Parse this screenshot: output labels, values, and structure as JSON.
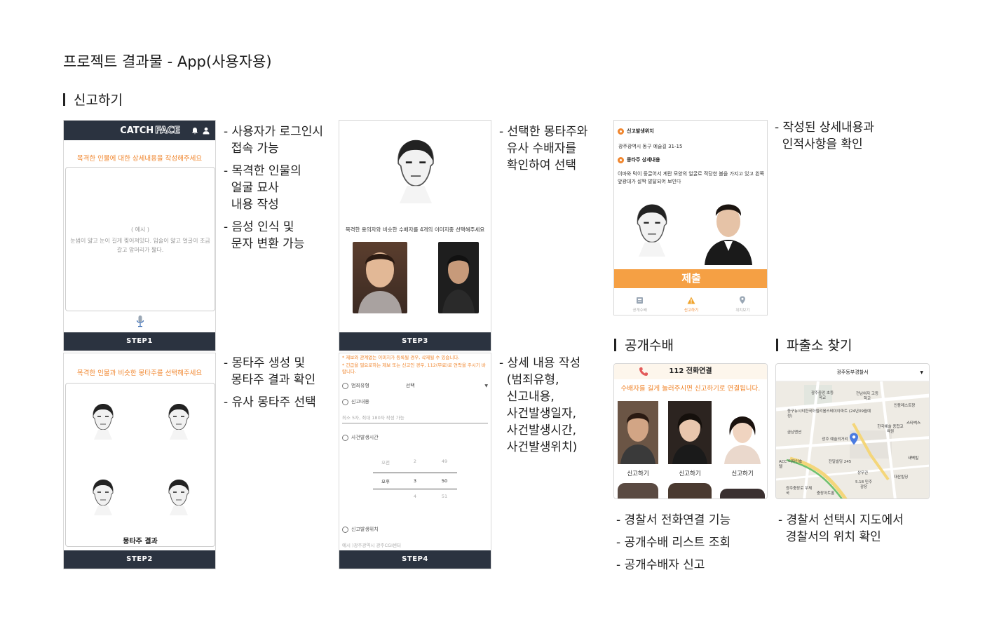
{
  "page_title": "프로젝트 결과물 - App(사용자용)",
  "sections": {
    "report": "신고하기",
    "wanted": "공개수배",
    "police": "파출소 찾기"
  },
  "phone1": {
    "logo_catch": "CATCH",
    "logo_face": "FACE",
    "prompt": "목격한 인물에 대한 상세내용을 작성해주세요",
    "example_label": "( 예시 )",
    "example_text": "눈썹이 얇고 눈이 길게 찢어져있다. 입술이 얇고 얼굴이 조금 갈고 앞머리가 짧다.",
    "step": "STEP1"
  },
  "phone2": {
    "prompt": "목격한 인물과 비슷한 몽타주를 선택해주세요",
    "result_label": "몽타주 결과",
    "step": "STEP2"
  },
  "phone3": {
    "prompt": "목격한 용의자와 비슷한 수배자를 4개의 이미지중 선택해주세요",
    "step": "STEP3"
  },
  "phone4": {
    "notice1": "* 제보와 관계없는 이미지가 등록될 경우, 삭제될 수 있습니다.",
    "notice2": "* 긴급을 필요로하는 제보 또는 신고인 경우, 112(무료)로 연락을 주시기 바랍니다.",
    "crime_type_label": "범죄유형",
    "crime_type_value": "선택",
    "content_label": "신고내용",
    "content_placeholder": "최소 5자, 최대 180자 작성 가능",
    "time_label": "사건발생시간",
    "time_rows": [
      [
        "오전",
        "2",
        "49"
      ],
      [
        "오후",
        "3",
        "50"
      ],
      [
        "",
        "4",
        "51"
      ]
    ],
    "location_label": "신고발생위치",
    "location_placeholder": "예시 )광주광역시 광주CGI센터",
    "step": "STEP4"
  },
  "phone5": {
    "loc_label": "신고발생위치",
    "loc_value": "광주광역시 동구 예술길 31-15",
    "detail_label": "몽타주 상세내용",
    "detail_text": "이마와 턱이 둥글어서 계란 모양의 얼굴로 적당한 볼을 가지고 있고 왼쪽 앞광대가 살짝 발달되어 보인다",
    "submit": "제출",
    "nav": [
      "공개수배",
      "신고하기",
      "위치보기"
    ]
  },
  "phone6": {
    "header": "112 전화연결",
    "banner": "수배자를 길게 눌러주시면 신고하기로 연결됩니다.",
    "report_btn": "신고하기"
  },
  "phone7": {
    "select_value": "광주동부경찰서",
    "map_labels": [
      "광주중앙 초등학교",
      "전남여자 고등학교",
      "동구뉴시티한국아델리움스테이아파트 (24년09월예정)",
      "인동레스트장",
      "한국예술 종합교육원",
      "광주 예술의거리",
      "금남맨션",
      "전일빌딩 245",
      "ACC 디자인호텔",
      "상무관",
      "광주충장로 우체국",
      "충장아트홀",
      "5.18 민주광장",
      "대산빌딩",
      "스타벅스",
      "새벽빌"
    ]
  },
  "descriptions": {
    "d1": [
      "- 사용자가 로그인시",
      "  접속 가능"
    ],
    "d2": [
      "- 목격한 인물의",
      "  얼굴 묘사",
      "  내용 작성"
    ],
    "d3": [
      "- 음성 인식 및",
      "  문자 변환 가능"
    ],
    "d4": [
      "- 몽타주 생성 및",
      "  몽타주 결과 확인"
    ],
    "d5": [
      "- 유사 몽타주 선택"
    ],
    "d6": [
      "- 선택한 몽타주와",
      "  유사 수배자를",
      "  확인하여 선택"
    ],
    "d7": [
      "- 상세 내용 작성",
      "  (범죄유형,",
      "  신고내용,",
      "  사건발생일자,",
      "  사건발생시간,",
      "  사건발생위치)"
    ],
    "d8": [
      "- 작성된 상세내용과",
      "  인적사항을 확인"
    ],
    "d9": [
      "- 경찰서 전화연결 기능"
    ],
    "d10": [
      "- 공개수배 리스트 조회"
    ],
    "d11": [
      "- 공개수배자 신고"
    ],
    "d12": [
      "- 경찰서 선택시 지도에서",
      "  경찰서의 위치 확인"
    ]
  },
  "colors": {
    "accent": "#f0862e",
    "step_bar": "#2b3340"
  }
}
